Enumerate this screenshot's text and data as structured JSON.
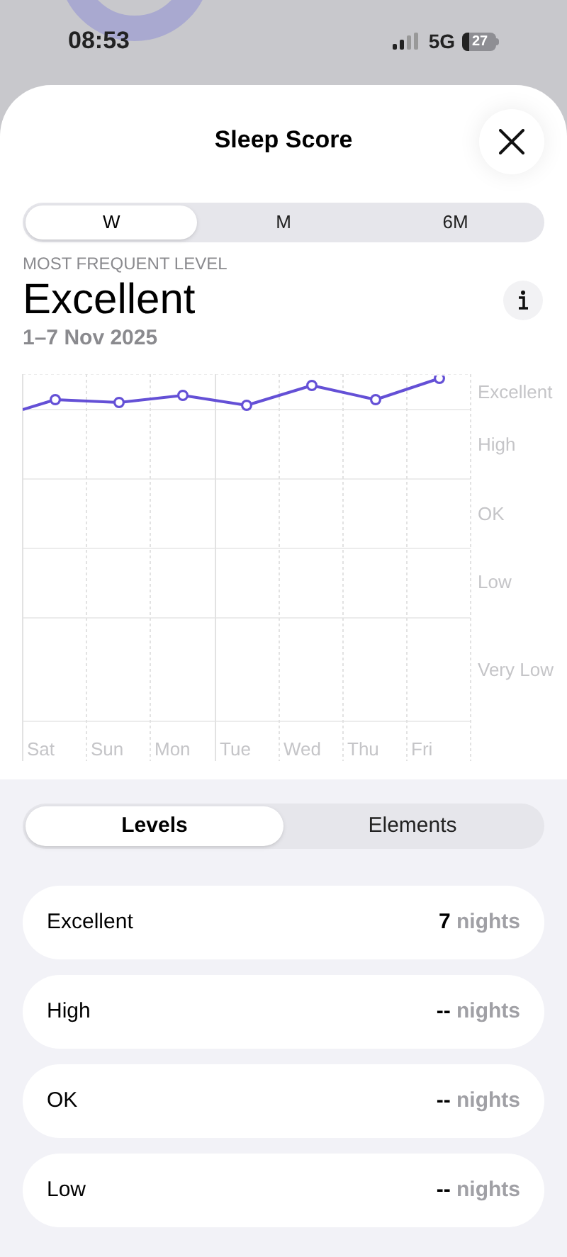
{
  "status_bar": {
    "time": "08:53",
    "network": "5G",
    "battery": "27"
  },
  "sheet": {
    "title": "Sleep Score"
  },
  "period_tabs": [
    {
      "label": "W",
      "selected": true
    },
    {
      "label": "M",
      "selected": false
    },
    {
      "label": "6M",
      "selected": false
    }
  ],
  "summary": {
    "caption": "MOST FREQUENT LEVEL",
    "value": "Excellent",
    "date_range": "1–7 Nov 2025"
  },
  "chart": {
    "y_labels": [
      "Excellent",
      "High",
      "OK",
      "Low",
      "Very Low"
    ],
    "x_labels": [
      "Sat",
      "Sun",
      "Mon",
      "Tue",
      "Wed",
      "Thu",
      "Fri"
    ]
  },
  "view_tabs": [
    {
      "label": "Levels",
      "selected": true
    },
    {
      "label": "Elements",
      "selected": false
    }
  ],
  "levels": [
    {
      "label": "Excellent",
      "count": "7",
      "unit": "nights"
    },
    {
      "label": "High",
      "count": "--",
      "unit": "nights"
    },
    {
      "label": "OK",
      "count": "--",
      "unit": "nights"
    },
    {
      "label": "Low",
      "count": "--",
      "unit": "nights"
    }
  ]
}
